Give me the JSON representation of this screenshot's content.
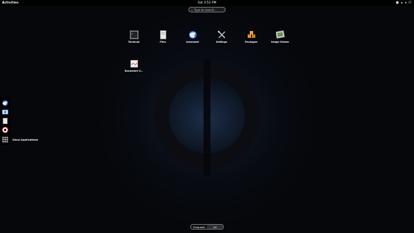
{
  "topbar": {
    "activities": "Activities",
    "clock": "Sat 3:52 PM",
    "tray_icons": [
      "accessibility-icon",
      "network-icon",
      "volume-icon",
      "power-icon"
    ]
  },
  "search": {
    "placeholder": "Type to search..."
  },
  "apps": [
    {
      "label": "Terminal",
      "icon": "terminal-icon"
    },
    {
      "label": "Files",
      "icon": "files-icon"
    },
    {
      "label": "Iceweasel",
      "icon": "browser-icon"
    },
    {
      "label": "Settings",
      "icon": "settings-icon"
    },
    {
      "label": "Packages",
      "icon": "packages-icon"
    },
    {
      "label": "Image Viewer",
      "icon": "image-viewer-icon"
    },
    {
      "label": "Document V...",
      "icon": "document-viewer-icon"
    }
  ],
  "dash": {
    "items": [
      "browser-icon",
      "mail-icon",
      "files-icon",
      "help-icon",
      "show-apps-icon"
    ],
    "show_apps_label": "Show Applications"
  },
  "view_switch": {
    "frequent": "Frequent",
    "all": "All",
    "active": "All"
  }
}
